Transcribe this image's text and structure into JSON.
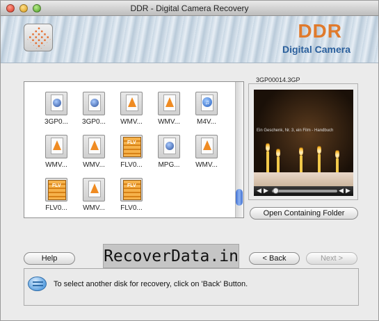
{
  "window": {
    "title": "DDR - Digital Camera Recovery"
  },
  "banner": {
    "brand": "DDR",
    "subtitle": "Digital Camera"
  },
  "files": [
    {
      "label": "3GP0...",
      "icon": "quicktime-file-icon",
      "kind": "qt"
    },
    {
      "label": "3GP0...",
      "icon": "quicktime-file-icon",
      "kind": "qt"
    },
    {
      "label": "WMV...",
      "icon": "vlc-file-icon",
      "kind": "vlc"
    },
    {
      "label": "WMV...",
      "icon": "vlc-file-icon",
      "kind": "vlc"
    },
    {
      "label": "M4V...",
      "icon": "mpeg4-file-icon",
      "kind": "m4"
    },
    {
      "label": "WMV...",
      "icon": "vlc-file-icon",
      "kind": "vlc"
    },
    {
      "label": "WMV...",
      "icon": "vlc-file-icon",
      "kind": "vlc"
    },
    {
      "label": "FLV0...",
      "icon": "flv-file-icon",
      "kind": "flv"
    },
    {
      "label": "MPG...",
      "icon": "quicktime-file-icon",
      "kind": "qt"
    },
    {
      "label": "WMV...",
      "icon": "vlc-file-icon",
      "kind": "vlc"
    },
    {
      "label": "FLV0...",
      "icon": "flv-file-icon",
      "kind": "flv"
    },
    {
      "label": "WMV...",
      "icon": "vlc-file-icon",
      "kind": "vlc"
    },
    {
      "label": "FLV0...",
      "icon": "flv-file-icon",
      "kind": "flv"
    }
  ],
  "preview": {
    "filename": "3GP00014.3GP",
    "caption": "Ein Geschenk, Nr. 3, ein Film - Handbuch"
  },
  "buttons": {
    "open_folder": "Open Containing Folder",
    "help": "Help",
    "back": "< Back",
    "next": "Next >"
  },
  "watermark": "RecoverData.in",
  "status": {
    "message": "To select another disk for recovery, click on 'Back' Button."
  }
}
